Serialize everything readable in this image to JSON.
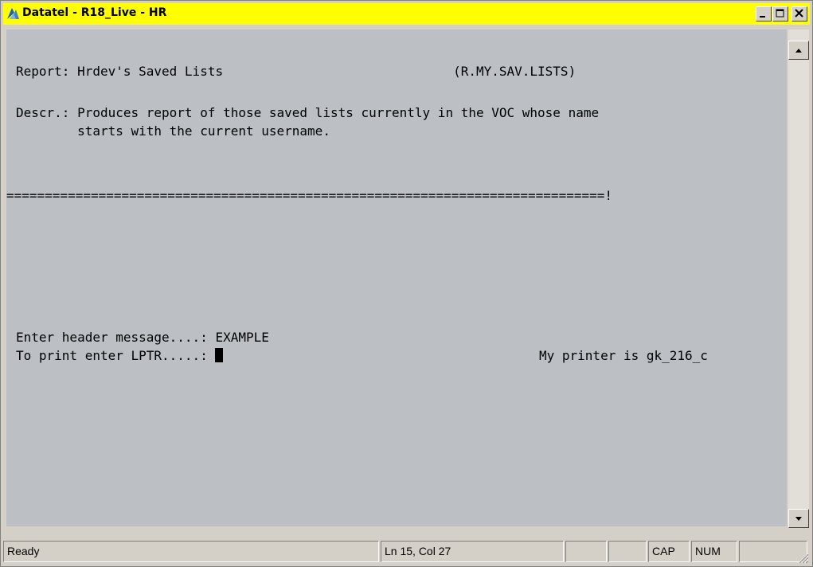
{
  "window": {
    "title": "Datatel - R18_Live - HR"
  },
  "terminal": {
    "report_line": "Report: Hrdev's Saved Lists                              (R.MY.SAV.LISTS)",
    "descr_line1": "Descr.: Produces report of those saved lists currently in the VOC whose name",
    "descr_line2": "        starts with the current username.",
    "separator": "==============================================================================!",
    "header_prompt": "Enter header message....: ",
    "header_value": "EXAMPLE",
    "print_prompt": "To print enter LPTR.....: ",
    "printer_info": "My printer is gk_216_c"
  },
  "statusbar": {
    "status": "Ready",
    "position": "Ln 15, Col 27",
    "cap": "CAP",
    "num": "NUM"
  },
  "icons": {
    "app": "datatel-app-icon",
    "minimize": "minimize-icon",
    "maximize": "maximize-icon",
    "close": "close-icon",
    "scroll_up": "arrow-up-icon",
    "scroll_down": "arrow-down-icon",
    "resize": "resize-grip-icon"
  }
}
